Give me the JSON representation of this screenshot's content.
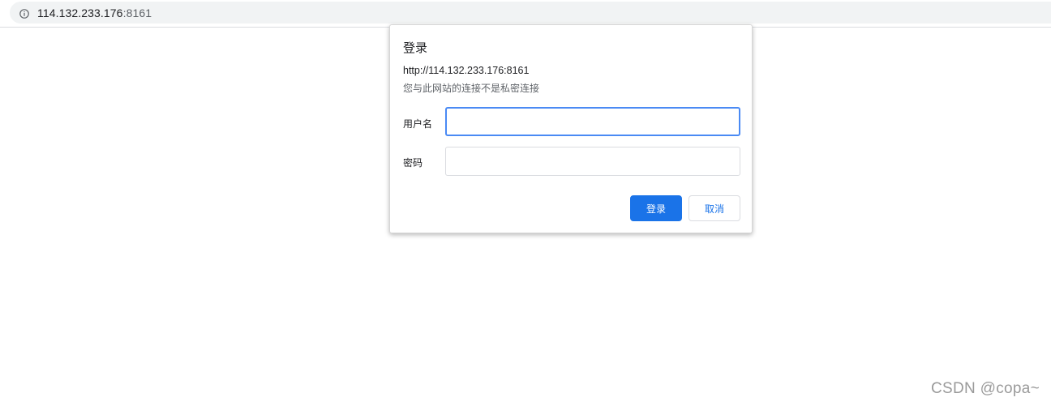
{
  "address_bar": {
    "host": "114.132.233.176",
    "port": ":8161",
    "icon": "info-icon"
  },
  "auth_dialog": {
    "title": "登录",
    "url": "http://114.132.233.176:8161",
    "warning": "您与此网站的连接不是私密连接",
    "username_label": "用户名",
    "username_value": "",
    "password_label": "密码",
    "password_value": "",
    "login_button": "登录",
    "cancel_button": "取消"
  },
  "colors": {
    "accent": "#1a73e8",
    "focus_border": "#4a8af4"
  },
  "watermark": "CSDN @copa~"
}
